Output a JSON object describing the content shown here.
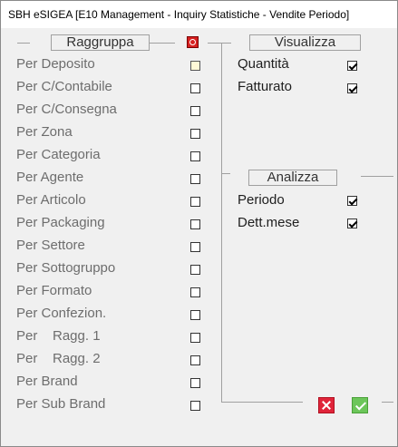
{
  "window": {
    "title": "SBH eSIGEA [E10 Management - Inquiry Statistiche - Vendite Periodo]"
  },
  "raggruppa": {
    "caption": "Raggruppa",
    "items": [
      {
        "label": "Per Deposito",
        "checked": false,
        "active": true
      },
      {
        "label": "Per C/Contabile",
        "checked": false
      },
      {
        "label": "Per C/Consegna",
        "checked": false
      },
      {
        "label": "Per Zona",
        "checked": false
      },
      {
        "label": "Per Categoria",
        "checked": false
      },
      {
        "label": "Per Agente",
        "checked": false
      },
      {
        "label": "Per Articolo",
        "checked": false
      },
      {
        "label": "Per Packaging",
        "checked": false
      },
      {
        "label": "Per Settore",
        "checked": false
      },
      {
        "label": "Per Sottogruppo",
        "checked": false
      },
      {
        "label": "Per Formato",
        "checked": false
      },
      {
        "label": "Per Confezion.",
        "checked": false
      },
      {
        "label": "Per    Ragg. 1",
        "checked": false
      },
      {
        "label": "Per    Ragg. 2",
        "checked": false
      },
      {
        "label": "Per Brand",
        "checked": false
      },
      {
        "label": "Per Sub Brand",
        "checked": false
      }
    ]
  },
  "visualizza": {
    "caption": "Visualizza",
    "items": [
      {
        "label": "Quantità",
        "checked": true
      },
      {
        "label": "Fatturato",
        "checked": true
      }
    ]
  },
  "analizza": {
    "caption": "Analizza",
    "items": [
      {
        "label": "Periodo",
        "checked": true
      },
      {
        "label": "Dett.mese",
        "checked": true
      }
    ]
  },
  "colors": {
    "cancel": "#e0243a",
    "confirm": "#6cc65a",
    "toggle": "#d62020"
  },
  "icons": {
    "toggle": "record-toggle-icon",
    "cancel": "cancel-icon",
    "confirm": "confirm-icon"
  }
}
